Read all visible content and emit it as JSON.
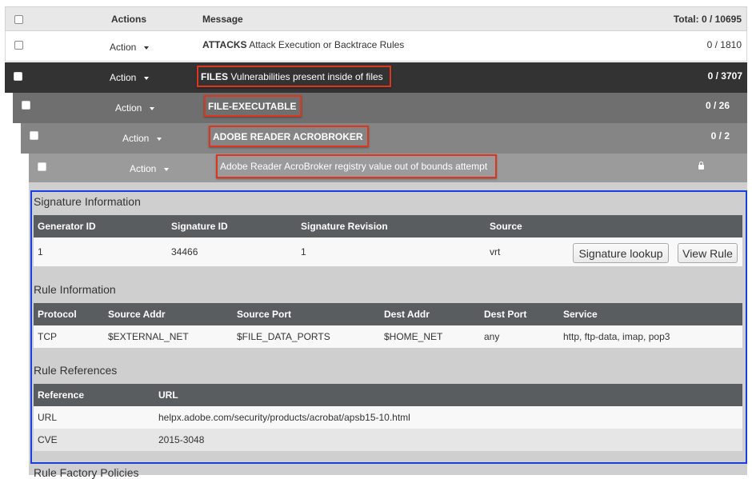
{
  "header": {
    "actions_label": "Actions",
    "message_label": "Message",
    "total_label": "Total: 0 / 10695"
  },
  "rows": [
    {
      "action": "Action",
      "category": "ATTACKS",
      "description": "Attack Execution or Backtrace Rules",
      "count": "0 / 1810"
    },
    {
      "action": "Action",
      "category": "FILES",
      "description": "Vulnerabilities present inside of files",
      "count": "0 / 3707"
    },
    {
      "action": "Action",
      "category": "FILE-EXECUTABLE",
      "description": "",
      "count": "0 / 26"
    },
    {
      "action": "Action",
      "category": "ADOBE READER ACROBROKER",
      "description": "",
      "count": "0 / 2"
    },
    {
      "action": "Action",
      "category": "",
      "description": "Adobe Reader AcroBroker registry value out of bounds attempt",
      "count": ""
    }
  ],
  "signature_info": {
    "title": "Signature Information",
    "headers": [
      "Generator ID",
      "Signature ID",
      "Signature Revision",
      "Source"
    ],
    "values": [
      "1",
      "34466",
      "1",
      "vrt"
    ],
    "lookup_button": "Signature lookup",
    "view_rule_button": "View Rule"
  },
  "rule_info": {
    "title": "Rule Information",
    "headers": [
      "Protocol",
      "Source Addr",
      "Source Port",
      "Dest Addr",
      "Dest Port",
      "Service"
    ],
    "values": [
      "TCP",
      "$EXTERNAL_NET",
      "$FILE_DATA_PORTS",
      "$HOME_NET",
      "any",
      "http, ftp-data, imap, pop3"
    ]
  },
  "rule_refs": {
    "title": "Rule References",
    "headers": [
      "Reference",
      "URL"
    ],
    "rows": [
      [
        "URL",
        "helpx.adobe.com/security/products/acrobat/apsb15-10.html"
      ],
      [
        "CVE",
        "2015-3048"
      ]
    ]
  },
  "next_section_title": "Rule Factory Policies",
  "colors": {
    "highlight_red": "#e0341c",
    "highlight_blue": "#1a3fe0",
    "row_dark": "#333333",
    "row_level2": "#6f6f6f",
    "row_level3": "#858585",
    "row_level4": "#9b9b9b"
  },
  "icons": [
    "checkbox",
    "caret-down-icon",
    "lock-icon"
  ]
}
